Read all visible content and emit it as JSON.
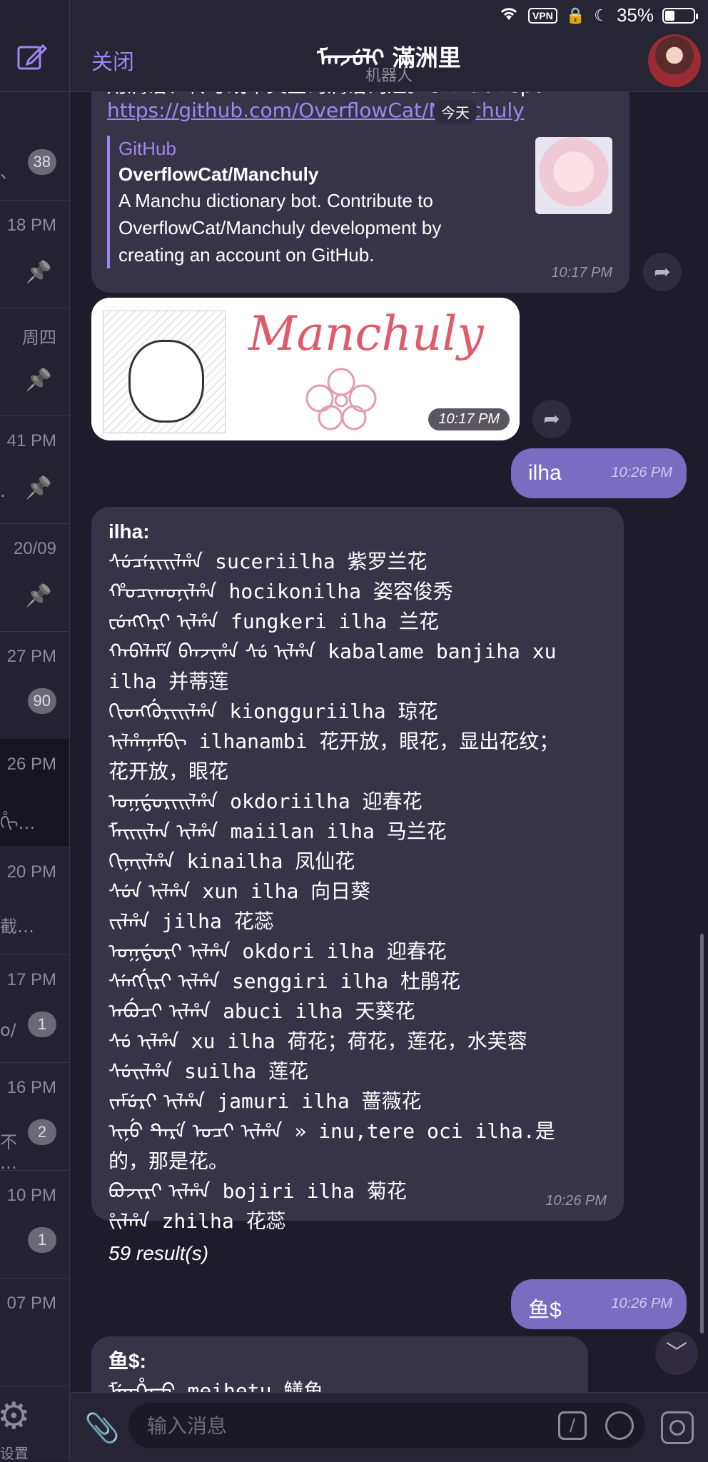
{
  "status_bar": {
    "vpn": "VPN",
    "battery": "35%",
    "battery_level": 0.35
  },
  "sidebar": {
    "chats": [
      {
        "time": "",
        "snippet": "、",
        "badge": "38",
        "pinned": false
      },
      {
        "time": "18 PM",
        "snippet": "",
        "badge": "",
        "pinned": true
      },
      {
        "time": "周四",
        "snippet": "",
        "badge": "",
        "pinned": true
      },
      {
        "time": "41 PM",
        "snippet": ".",
        "badge": "",
        "pinned": true
      },
      {
        "time": "20/09",
        "snippet": "",
        "badge": "",
        "pinned": true
      },
      {
        "time": "27 PM",
        "snippet": "",
        "badge": "90",
        "pinned": false
      },
      {
        "time": "26 PM",
        "snippet": "ᡥᡳ…",
        "badge": "",
        "pinned": false
      },
      {
        "time": "20 PM",
        "snippet": "截…",
        "badge": "",
        "pinned": false
      },
      {
        "time": "17 PM",
        "snippet": "o/",
        "badge": "1",
        "pinned": false
      },
      {
        "time": "16 PM",
        "snippet": "不\n…",
        "badge": "2",
        "pinned": false
      },
      {
        "time": "10 PM",
        "snippet": "",
        "badge": "1",
        "pinned": false
      },
      {
        "time": "07 PM",
        "snippet": "",
        "badge": "",
        "pinned": false
      }
    ],
    "settings_label": "设置"
  },
  "header": {
    "close_label": "关闭",
    "title": "ᠮᠠᠨᠵᡠᠯᡳ 滿洲里",
    "subtitle": "机器人"
  },
  "chat": {
    "date_pill": "今天",
    "msg1": {
      "text": "用满语、转写或中文查询满语词汇。Github repo:",
      "link": "https://github.com/OverflowCat/Manchuly",
      "preview_site": "GitHub",
      "preview_title": "OverflowCat/Manchuly",
      "preview_desc": [
        "A Manchu dictionary bot. Contribute to",
        "OverflowCat/Manchuly development by",
        "creating an account on GitHub."
      ],
      "time": "10:17 PM"
    },
    "sticker": {
      "word": "Manchuly",
      "time": "10:17 PM"
    },
    "out1": {
      "text": "ilha",
      "time": "10:26 PM"
    },
    "result": {
      "heading": "ilha:",
      "lines": [
        {
          "mnc": "ᠰᡠᠴᡝᡵᡳᡳᠯᡥᠠ",
          "rest": " suceriilha 紫罗兰花"
        },
        {
          "mnc": "ᡥᠣᠴᡳᡴᠣᠨᡳᠯᡥᠠ",
          "rest": " hocikonilha 姿容俊秀"
        },
        {
          "mnc": "ᡶᡠᠩᡴᡝᡵᡳ ᡳᠯᡥᠠ",
          "rest": " fungkeri ilha 兰花"
        },
        {
          "mnc": "ᡴᠠᠪᠠᠯᠠᠮᡝ ᠪᠠᠨᠵᡳᡥᠠ ᠰᡠ ᡳᠯᡥᠠ",
          "rest": " kabalame banjiha xu"
        },
        {
          "mnc": "",
          "rest": "ilha 并蒂莲"
        },
        {
          "mnc": "ᡴᡳᠣᠩᡤᡠᡵᡳᡳᠯᡥᠠ",
          "rest": " kiongguriilha 琼花"
        },
        {
          "mnc": "ᡳᠯᡥᠠᠨᠠᠮᠪᡳ",
          "rest": " ilhanambi 花开放，眼花，显出花纹；"
        },
        {
          "mnc": "",
          "rest": "花开放，眼花"
        },
        {
          "mnc": "ᠣᡴᡩᠣᡵᡳᡳᠯᡥᠠ",
          "rest": " okdoriilha 迎春花"
        },
        {
          "mnc": "ᠮᠠᡳᡳᠯᠠᠨ ᡳᠯᡥᠠ",
          "rest": " maiilan ilha 马兰花"
        },
        {
          "mnc": "ᡴᡳᠨᠠᡳᠯᡥᠠ",
          "rest": " kinailha 凤仙花"
        },
        {
          "mnc": "ᠰᡠᠨ ᡳᠯᡥᠠ",
          "rest": " xun ilha 向日葵"
        },
        {
          "mnc": "ᠵᡳᠯᡥᠠ",
          "rest": " jilha 花蕊"
        },
        {
          "mnc": "ᠣᡴᡩᠣᡵᡳ ᡳᠯᡥᠠ",
          "rest": " okdori ilha 迎春花"
        },
        {
          "mnc": "ᠰᡝᠩᡤᡳᡵᡳ ᡳᠯᡥᠠ",
          "rest": " senggiri ilha 杜鹃花"
        },
        {
          "mnc": "ᠠᠪᡠᠴᡳ ᡳᠯᡥᠠ",
          "rest": " abuci ilha 天葵花"
        },
        {
          "mnc": "ᠰᡠ ᡳᠯᡥᠠ",
          "rest": " xu ilha 荷花；荷花，莲花，水芙蓉"
        },
        {
          "mnc": "ᠰᡠᡳᠯᡥᠠ",
          "rest": " suilha 莲花"
        },
        {
          "mnc": "ᠵᠠᠮᡠᡵᡳ ᡳᠯᡥᠠ",
          "rest": " jamuri ilha 蔷薇花"
        },
        {
          "mnc": "ᡳᠨᡠ ᡨᡝᡵᡝ ᠣᠴᡳ ᡳᠯᡥᠠ",
          "rest": " » inu,tere oci ilha.是"
        },
        {
          "mnc": "",
          "rest": "的，那是花。"
        },
        {
          "mnc": "ᠪᠣᠵᡳᡵᡳ ᡳᠯᡥᠠ",
          "rest": " bojiri ilha 菊花"
        },
        {
          "mnc": "ᡷᡳᠯᡥᠠ",
          "rest": " zhilha 花蕊"
        }
      ],
      "count": "59 result(s)",
      "time": "10:26 PM"
    },
    "out2": {
      "text": "鱼$",
      "time": "10:26 PM"
    },
    "result2": {
      "heading": "鱼$:",
      "first_line": "ᠮᡝᡳᡥᡝᡨᡠ meihetu 鳝鱼"
    }
  },
  "input": {
    "placeholder": "输入消息",
    "command_glyph": "/"
  },
  "colors": {
    "accent": "#9d88f0",
    "outgoing_bubble": "#7a6cc0",
    "incoming_bubble": "#383448",
    "background": "#1e1c2a"
  }
}
